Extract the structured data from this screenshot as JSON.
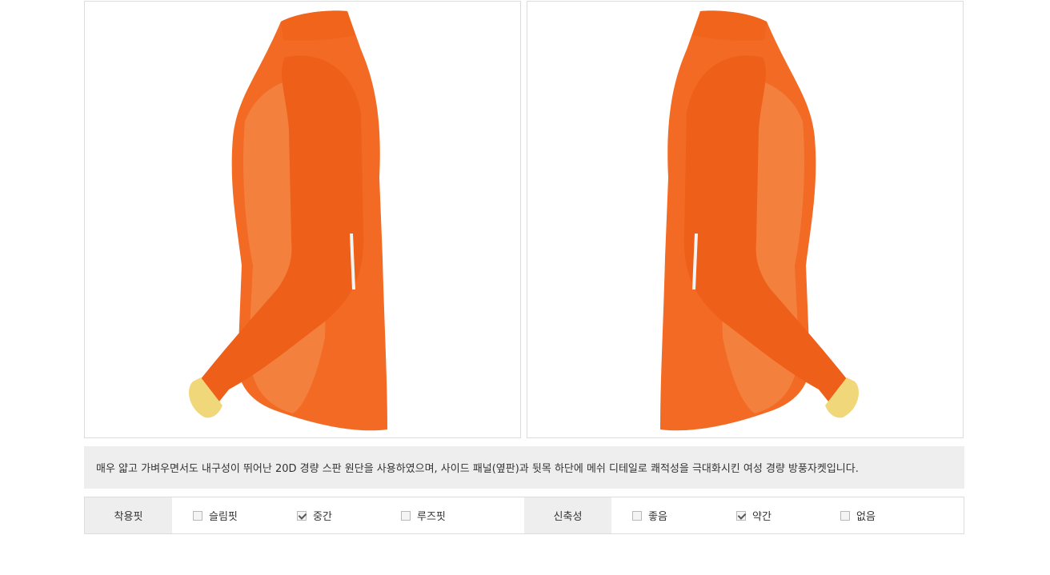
{
  "product": {
    "images": [
      {
        "alt_icon": "jacket-left-side-photo"
      },
      {
        "alt_icon": "jacket-right-side-photo"
      }
    ],
    "description": "매우 얇고 가벼우면서도 내구성이 뛰어난 20D 경량 스판 원단을 사용하였으며, 사이드 패널(옆판)과 뒷목 하단에 메쉬 디테일로 쾌적성을 극대화시킨 여성 경량 방풍자켓입니다."
  },
  "spec": {
    "fit": {
      "label": "착용핏",
      "options": [
        {
          "label": "슬림핏",
          "checked": false
        },
        {
          "label": "중간",
          "checked": true
        },
        {
          "label": "루즈핏",
          "checked": false
        }
      ]
    },
    "stretch": {
      "label": "신축성",
      "options": [
        {
          "label": "좋음",
          "checked": false
        },
        {
          "label": "약간",
          "checked": true
        },
        {
          "label": "없음",
          "checked": false
        }
      ]
    }
  },
  "colors": {
    "jacket": "#f26a24",
    "cuff": "#f0d77a",
    "panel": "#f58a4a"
  }
}
